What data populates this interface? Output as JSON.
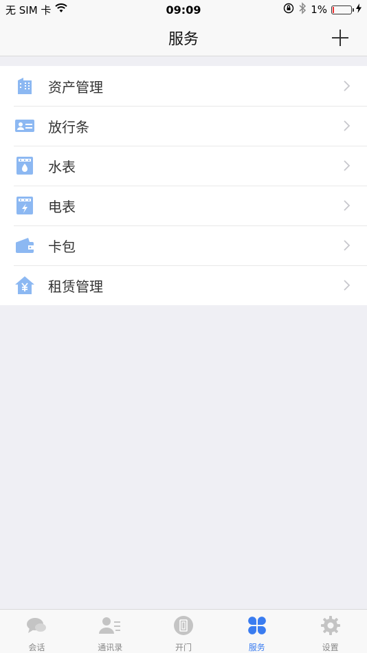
{
  "status_bar": {
    "carrier": "无 SIM 卡",
    "time": "09:09",
    "battery_percent": "1%",
    "battery_level": 0.01
  },
  "nav": {
    "title": "服务"
  },
  "items": [
    {
      "label": "资产管理",
      "icon": "building-icon"
    },
    {
      "label": "放行条",
      "icon": "id-card-icon"
    },
    {
      "label": "水表",
      "icon": "water-meter-icon"
    },
    {
      "label": "电表",
      "icon": "electric-meter-icon"
    },
    {
      "label": "卡包",
      "icon": "wallet-icon"
    },
    {
      "label": "租赁管理",
      "icon": "house-yen-icon"
    }
  ],
  "tabs": [
    {
      "label": "会话",
      "icon": "chat-icon",
      "active": false
    },
    {
      "label": "通讯录",
      "icon": "contacts-icon",
      "active": false
    },
    {
      "label": "开门",
      "icon": "door-icon",
      "active": false
    },
    {
      "label": "服务",
      "icon": "clover-icon",
      "active": true
    },
    {
      "label": "设置",
      "icon": "gear-icon",
      "active": false
    }
  ],
  "colors": {
    "accent": "#3a7cf0",
    "icon_blue": "#8cb8f2",
    "inactive": "#c4c4c4"
  }
}
